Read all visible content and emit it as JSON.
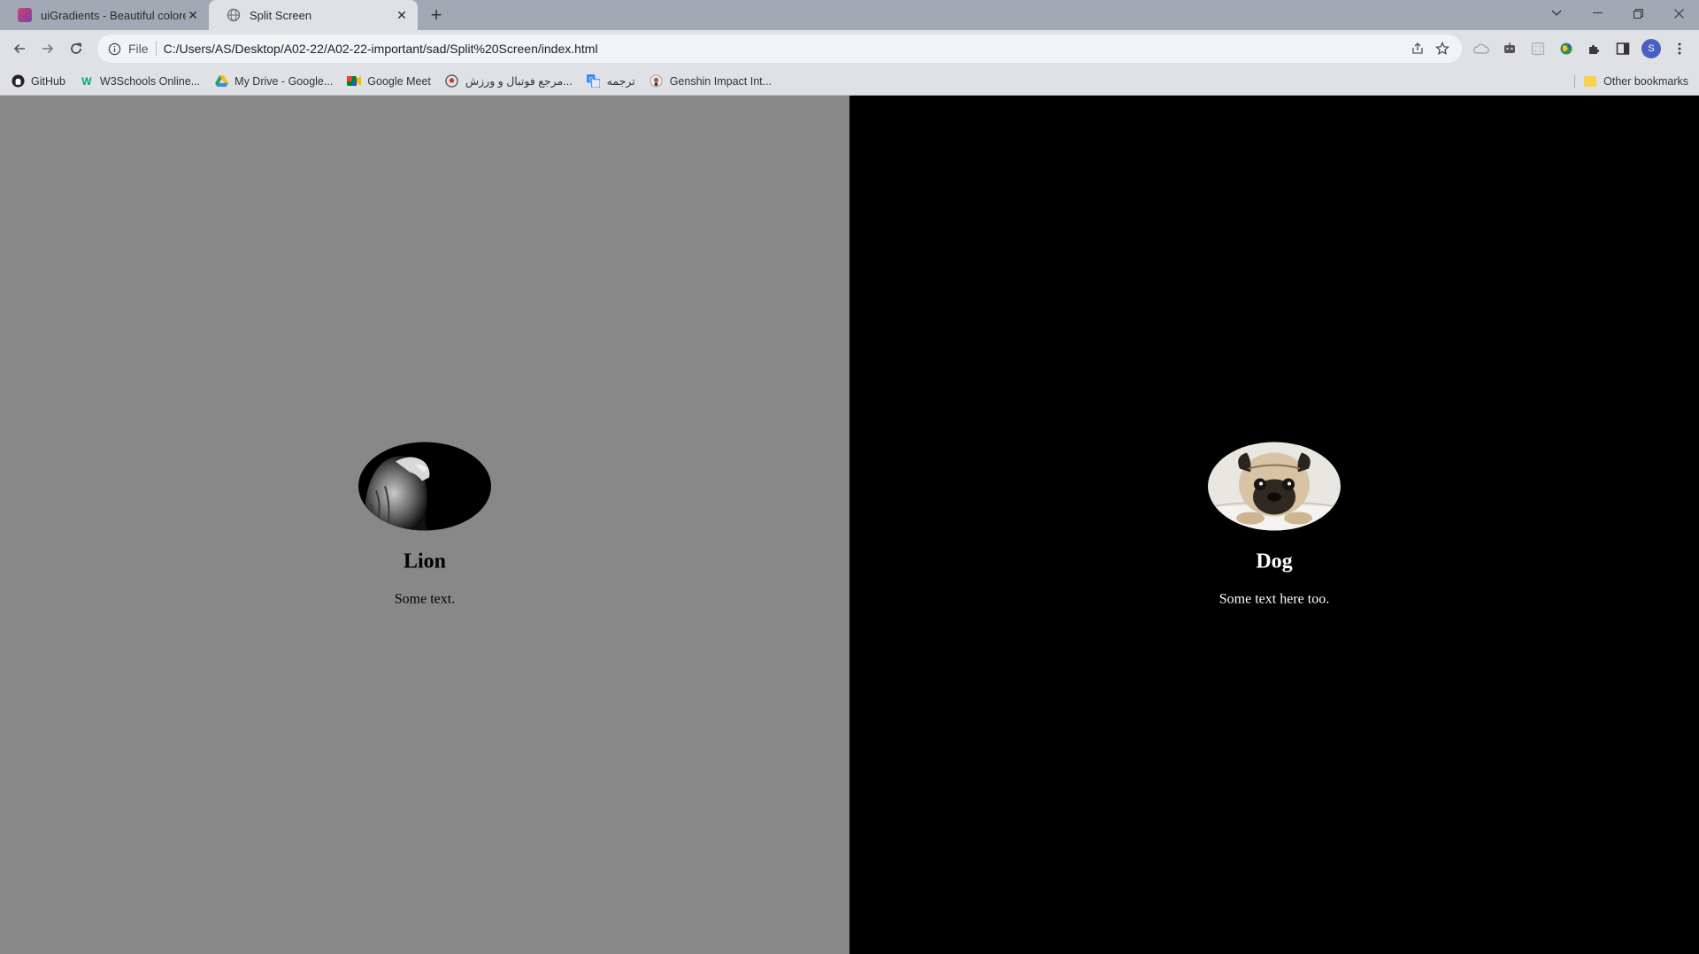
{
  "browser": {
    "tabs": [
      {
        "title": "uiGradients - Beautiful colored gradients",
        "active": false
      },
      {
        "title": "Split Screen",
        "active": true
      }
    ],
    "address": {
      "scheme_label": "File",
      "url": "C:/Users/AS/Desktop/A02-22/A02-22-important/sad/Split%20Screen/index.html"
    },
    "profile_initial": "S",
    "bookmarks": [
      {
        "label": "GitHub",
        "icon": "github-icon"
      },
      {
        "label": "W3Schools Online...",
        "icon": "w3schools-icon"
      },
      {
        "label": "My Drive - Google...",
        "icon": "google-drive-icon"
      },
      {
        "label": "Google Meet",
        "icon": "google-meet-icon"
      },
      {
        "label": "مرجع فوتبال و ورزش...",
        "icon": "football-icon"
      },
      {
        "label": "ترجمه",
        "icon": "translate-icon"
      },
      {
        "label": "Genshin Impact Int...",
        "icon": "genshin-icon"
      }
    ],
    "other_bookmarks": "Other bookmarks"
  },
  "page": {
    "left": {
      "heading": "Lion",
      "text": "Some text.",
      "bg": "#888888",
      "image": "lion-portrait"
    },
    "right": {
      "heading": "Dog",
      "text": "Some text here too.",
      "bg": "#000000",
      "image": "pug-photo"
    }
  }
}
